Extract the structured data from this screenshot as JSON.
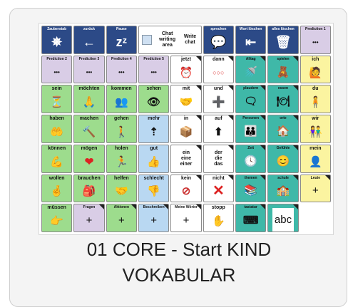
{
  "card": {
    "title_line1": "01 CORE - Start KIND",
    "title_line2": "VOKABULAR"
  },
  "board": {
    "row1": [
      {
        "label": "Zauberstab",
        "icon": "✵"
      },
      {
        "label": "zurück",
        "icon": "←"
      },
      {
        "label": "Pause",
        "icon": "zᶻ"
      },
      {
        "label": "Chat writing area"
      },
      {
        "label": "Write chat"
      },
      {
        "label": "sprechen",
        "icon": "💬"
      },
      {
        "label": "Wort löschen",
        "icon": "⇤"
      },
      {
        "label": "alles löschen",
        "icon": "🗑"
      }
    ],
    "predictions": [
      {
        "label": "Prediction 1",
        "dots": "•••"
      },
      {
        "label": "Prediction 2",
        "dots": "•••"
      },
      {
        "label": "Prediction 3",
        "dots": "•••"
      },
      {
        "label": "Prediction 4",
        "dots": "•••"
      },
      {
        "label": "Prediction 5",
        "dots": "•••"
      }
    ],
    "row2_rest": [
      {
        "label": "jetzt",
        "icon": "⏰"
      },
      {
        "label": "dann",
        "icon": "○○○"
      },
      {
        "label": "Alltag",
        "icon": "🚿"
      },
      {
        "label": "spielen",
        "icon": "🧸"
      }
    ],
    "row3": [
      {
        "label": "ich",
        "icon": "🙋"
      },
      {
        "label": "sein",
        "icon": "⏳"
      },
      {
        "label": "möchten",
        "icon": "🙏"
      },
      {
        "label": "kommen",
        "icon": "👥"
      },
      {
        "label": "sehen",
        "icon": "👁"
      },
      {
        "label": "mit",
        "icon": "🤝"
      },
      {
        "label": "und",
        "icon": "➕"
      },
      {
        "label": "plaudern",
        "icon": "🗨"
      },
      {
        "label": "essen",
        "icon": "🍽"
      }
    ],
    "row4": [
      {
        "label": "du",
        "icon": "🧍"
      },
      {
        "label": "haben",
        "icon": "🤲"
      },
      {
        "label": "machen",
        "icon": "🔨"
      },
      {
        "label": "gehen",
        "icon": "🚶"
      },
      {
        "label": "mehr",
        "icon": "⇡"
      },
      {
        "label": "in",
        "icon": "📦"
      },
      {
        "label": "auf",
        "icon": "⬆"
      },
      {
        "label": "Personen",
        "icon": "👪"
      },
      {
        "label": "orte",
        "icon": "🏠"
      }
    ],
    "row5": [
      {
        "label": "wir",
        "icon": "👫"
      },
      {
        "label": "können",
        "icon": "💪"
      },
      {
        "label": "mögen",
        "icon": "❤"
      },
      {
        "label": "holen",
        "icon": "🏃"
      },
      {
        "label": "gut",
        "icon": "👍"
      },
      {
        "label": "ein\neine\neiner"
      },
      {
        "label": "der\ndie\ndas"
      },
      {
        "label": "Zeit",
        "icon": "🕓"
      },
      {
        "label": "Gefühle",
        "icon": "😊"
      }
    ],
    "row6": [
      {
        "label": "mein",
        "icon": "👤"
      },
      {
        "label": "wollen",
        "icon": "🤞"
      },
      {
        "label": "brauchen",
        "icon": "🎒"
      },
      {
        "label": "helfen",
        "icon": "🤝"
      },
      {
        "label": "schlecht",
        "icon": "👎"
      },
      {
        "label": "kein",
        "icon": "⊘"
      },
      {
        "label": "nicht",
        "icon": "✕"
      },
      {
        "label": "themen",
        "icon": "📚"
      },
      {
        "label": "schule",
        "icon": "🏫"
      }
    ],
    "row7": [
      {
        "label": "Leute",
        "icon": "+"
      },
      {
        "label": "müssen",
        "icon": "👉"
      },
      {
        "label": "Fragen",
        "icon": "+"
      },
      {
        "label": "Aktionen",
        "icon": "+"
      },
      {
        "label": "Beschreiben",
        "icon": "+"
      },
      {
        "label": "Meine Wörter",
        "icon": "+"
      },
      {
        "label": "stopp",
        "icon": "✋"
      },
      {
        "label": "tastatur",
        "icon": "⌨"
      },
      {
        "label": "abc",
        "icon": "abc"
      }
    ]
  }
}
